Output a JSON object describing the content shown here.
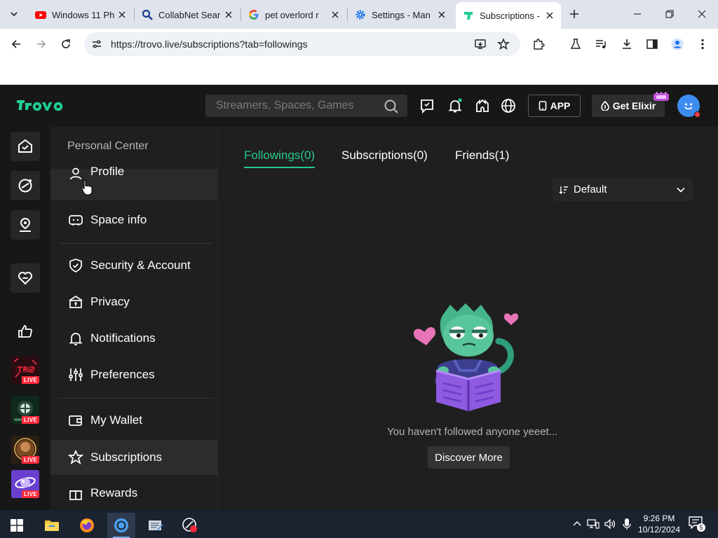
{
  "browser": {
    "tabs": [
      {
        "title": "Windows 11 Ph",
        "favicon": "youtube-icon",
        "active": false
      },
      {
        "title": "CollabNet Sear",
        "favicon": "search-icon",
        "active": false
      },
      {
        "title": "pet overlord r",
        "favicon": "google-icon",
        "active": false
      },
      {
        "title": "Settings - Man",
        "favicon": "gear-icon",
        "active": false
      },
      {
        "title": "Subscriptions -",
        "favicon": "trovo-icon",
        "active": true
      }
    ],
    "url": "https://trovo.live/subscriptions?tab=followings"
  },
  "header": {
    "logo": "trovo",
    "search_placeholder": "Streamers, Spaces, Games",
    "app_label": "APP",
    "elixir_label": "Get Elixir"
  },
  "sidebar": {
    "title": "Personal Center",
    "items": [
      {
        "label": "Profile",
        "icon": "profile-icon"
      },
      {
        "label": "Space info",
        "icon": "space-icon"
      },
      {
        "label": "Security & Account",
        "icon": "shield-icon"
      },
      {
        "label": "Privacy",
        "icon": "lock-icon"
      },
      {
        "label": "Notifications",
        "icon": "bell-icon"
      },
      {
        "label": "Preferences",
        "icon": "sliders-icon"
      },
      {
        "label": "My Wallet",
        "icon": "wallet-icon"
      },
      {
        "label": "Subscriptions",
        "icon": "star-icon"
      },
      {
        "label": "Rewards",
        "icon": "gift-icon"
      }
    ]
  },
  "rail": {
    "live_tag": "LIVE"
  },
  "main": {
    "tabs": [
      {
        "label": "Followings(0)",
        "active": true
      },
      {
        "label": "Subscriptions(0)",
        "active": false
      },
      {
        "label": "Friends(1)",
        "active": false
      }
    ],
    "sort_label": "Default",
    "empty_text": "You haven't followed anyone yeeet...",
    "discover_label": "Discover More"
  },
  "taskbar": {
    "time": "9:26 PM",
    "date": "10/12/2024",
    "notification_count": "5"
  },
  "colors": {
    "accent": "#27c98b",
    "header_bg": "#171717",
    "body_bg": "#1f1f1f",
    "live_red": "#ff2a3c"
  }
}
